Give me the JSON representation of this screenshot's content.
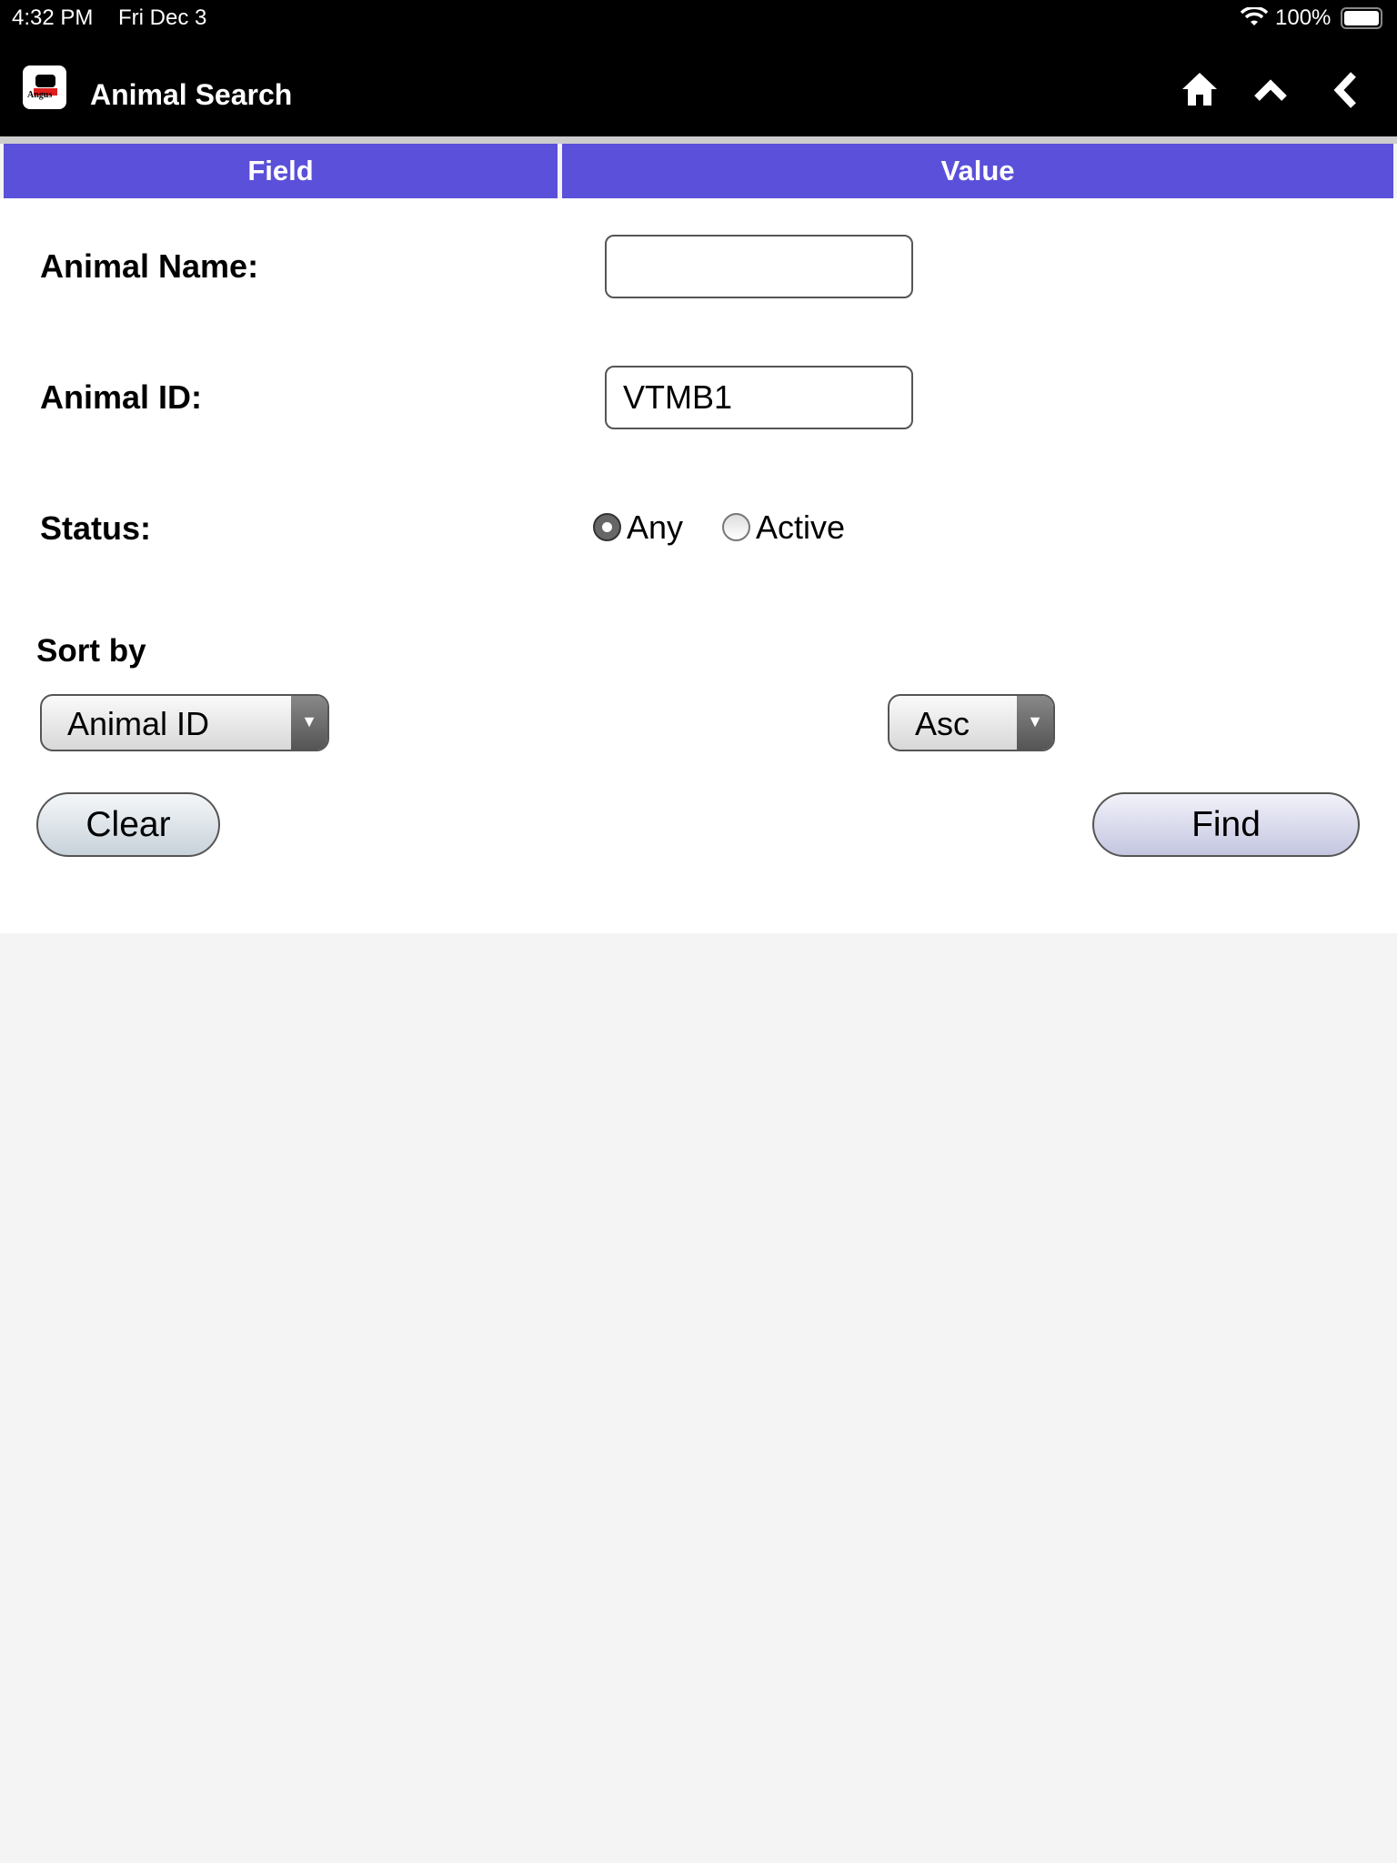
{
  "status_bar": {
    "time": "4:32 PM",
    "date": "Fri Dec 3",
    "battery": "100%"
  },
  "header": {
    "title": "Animal Search",
    "logo_text": "Angus",
    "icons": [
      "home-icon",
      "chevron-up-icon",
      "chevron-left-icon"
    ]
  },
  "table_header": {
    "field": "Field",
    "value": "Value"
  },
  "form": {
    "animal_name": {
      "label": "Animal Name:",
      "value": ""
    },
    "animal_id": {
      "label": "Animal ID:",
      "value": "VTMB1"
    },
    "status": {
      "label": "Status:",
      "options": [
        "Any",
        "Active"
      ],
      "selected": "Any"
    }
  },
  "sort": {
    "label": "Sort by",
    "field": "Animal ID",
    "order": "Asc"
  },
  "buttons": {
    "clear": "Clear",
    "find": "Find"
  },
  "colors": {
    "header_bg": "#000000",
    "table_header": "#5a50d9",
    "page_bg": "#f4f4f4"
  }
}
